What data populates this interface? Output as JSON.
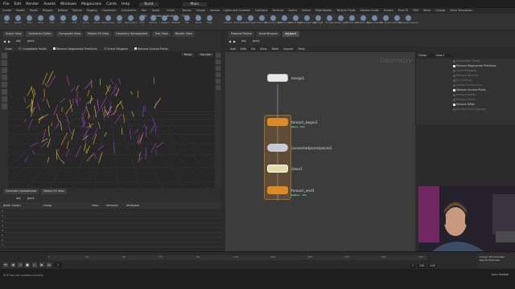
{
  "menubar": {
    "items": [
      "File",
      "Edit",
      "Render",
      "Assets",
      "Windows",
      "Megascans",
      "Cards",
      "Help"
    ],
    "desktop": "Build",
    "obj_path": "Main"
  },
  "shelf": {
    "tabs": [
      "Create",
      "Modify",
      "Model",
      "Polygon",
      "Deform",
      "Texture",
      "Rigging",
      "Characters",
      "Constraints",
      "Hair Utils",
      "Guide Process",
      "Guide Brushes",
      "Terrain FX",
      "Simple FX",
      "Volume",
      "Sop",
      "+"
    ],
    "tools": [
      "Box",
      "Sphere",
      "Tube",
      "Torus",
      "Grid",
      "Null",
      "Line",
      "Circle",
      "Curve",
      "Draw Curve",
      "Path",
      "Spray Paint",
      "Font",
      "Platonic",
      "L-System",
      "Metaball",
      "File",
      "Spiral",
      "Helix"
    ]
  },
  "shelf_right": {
    "tabs": [
      "Lights and Cameras",
      "Collisions",
      "Particles",
      "Grains",
      "Vellum",
      "Rigid Bodies",
      "Particle Fluids",
      "Viscous Fluids",
      "Oceans",
      "Pyro FX",
      "FEM",
      "Wires",
      "Crowds",
      "Drive Simulation"
    ],
    "tools": [
      "Camera",
      "Point Light",
      "Spot Light",
      "Area Light",
      "Geometry Light",
      "Volume Light",
      "Distant Light",
      "Environment Light",
      "Sky Light",
      "GI Light",
      "Caustic Light",
      "Portal Light",
      "Ambient Light",
      "Stereo Camera",
      "VR Camera",
      "Switcher",
      "Gamepad Camera"
    ]
  },
  "viewport": {
    "tabs": [
      "Scene View",
      "Animation Editor",
      "Composite View",
      "Motion FX View",
      "Geometry Spreadsheet",
      "Tree View",
      "Render View"
    ],
    "path": "obj",
    "node": "geo1",
    "persp": "Persp",
    "cam": "No cam",
    "paramstrip": {
      "node": "Clean",
      "options": [
        "Consolidate Points",
        "Remove Degenerate Primitives",
        "Orient Polygons",
        "Remove Unused Points"
      ]
    }
  },
  "bottom": {
    "tabs": [
      "Geometry Spreadsheet",
      "Motion FX View"
    ],
    "path": "obj",
    "node": "geo1",
    "header": [
      "Node: Clean1",
      "Group",
      "View",
      "Intrinsics",
      "Attributes"
    ],
    "rows": [
      "0",
      "1",
      "2",
      "3",
      "4",
      "5",
      "6",
      "7"
    ]
  },
  "network": {
    "tabs": [
      "Material Palette",
      "Asset Browser",
      "obj/geo1"
    ],
    "path": "obj",
    "node": "geo1",
    "menu": [
      "Add",
      "Edit",
      "Go",
      "View",
      "Tools",
      "Layout",
      "Help"
    ],
    "context_label": "Geometry",
    "nodes": {
      "merge": {
        "name": "merge1"
      },
      "begin": {
        "name": "foreach_begin3",
        "sub": "Piece : 150"
      },
      "connect": {
        "name": "connectadjacentpieces1"
      },
      "clean": {
        "name": "clean1"
      },
      "end": {
        "name": "foreach_end3",
        "sub": "Gather : 151"
      }
    }
  },
  "params": {
    "type": "Clean",
    "name": "clean1",
    "items": [
      {
        "label": "Consolidate Points",
        "on": false
      },
      {
        "label": "Remove Degenerate Primitives",
        "on": true
      },
      {
        "label": "Orient Polygons",
        "on": false
      },
      {
        "label": "Remove Winding",
        "on": false
      },
      {
        "label": "Fix Overlaps",
        "on": false
      },
      {
        "label": "Delete Overlap Pairs",
        "on": false
      },
      {
        "label": "Remove Unused Points",
        "on": true
      },
      {
        "label": "Remove Widths",
        "on": false
      },
      {
        "label": "Remove Points",
        "on": false
      },
      {
        "label": "Remove NANs",
        "on": true
      },
      {
        "label": "Manifold Only Topology",
        "on": false
      }
    ]
  },
  "timeline": {
    "ticks": [
      "1",
      "24",
      "48",
      "72",
      "96",
      "120",
      "144",
      "168",
      "192",
      "216",
      "240"
    ],
    "current_frame": "1",
    "start": "1",
    "end": "240",
    "end2": "240",
    "key_label": "0 keys, 0/0 channels",
    "all_channels": "Key All Channels"
  },
  "status": {
    "message": "SOP has not cooked correctly.",
    "update": "Auto Update"
  },
  "colors": {
    "node_orange": "#d98a2b",
    "node_white": "#e8e8e8",
    "node_wire": "#88a"
  }
}
